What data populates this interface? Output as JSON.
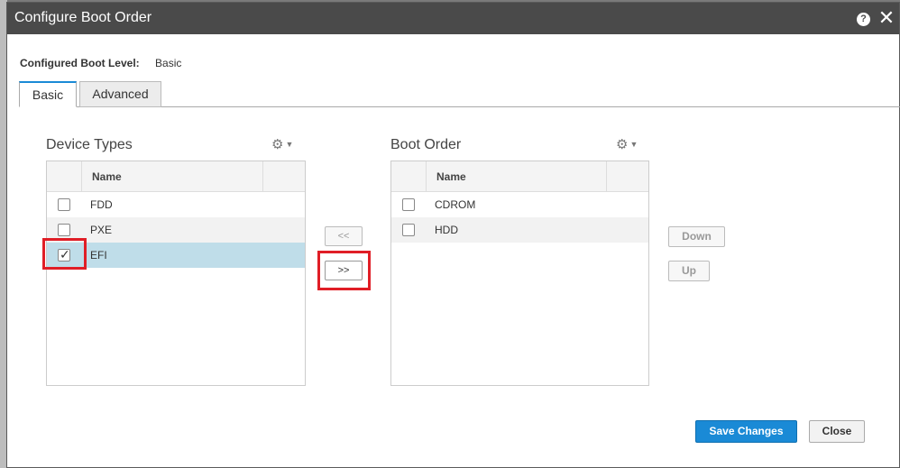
{
  "dialog": {
    "title": "Configure Boot Order"
  },
  "boot_level": {
    "label": "Configured Boot Level:",
    "value": "Basic"
  },
  "tabs": [
    {
      "label": "Basic",
      "active": true
    },
    {
      "label": "Advanced",
      "active": false
    }
  ],
  "device_types": {
    "title": "Device Types",
    "column": "Name",
    "rows": [
      {
        "label": "FDD",
        "checked": false
      },
      {
        "label": "PXE",
        "checked": false
      },
      {
        "label": "EFI",
        "checked": true
      }
    ]
  },
  "boot_order": {
    "title": "Boot Order",
    "column": "Name",
    "rows": [
      {
        "label": "CDROM",
        "checked": false
      },
      {
        "label": "HDD",
        "checked": false
      }
    ]
  },
  "move": {
    "left_label": "<<",
    "right_label": ">>"
  },
  "order_buttons": {
    "down_label": "Down",
    "up_label": "Up"
  },
  "footer": {
    "save_label": "Save Changes",
    "close_label": "Close"
  },
  "colors": {
    "primary": "#1a8ad6",
    "highlight": "#e01e26",
    "selected_row": "#bfdde9"
  },
  "icons": {
    "help": "help-icon",
    "close": "close-icon",
    "settings": "gear-icon"
  }
}
